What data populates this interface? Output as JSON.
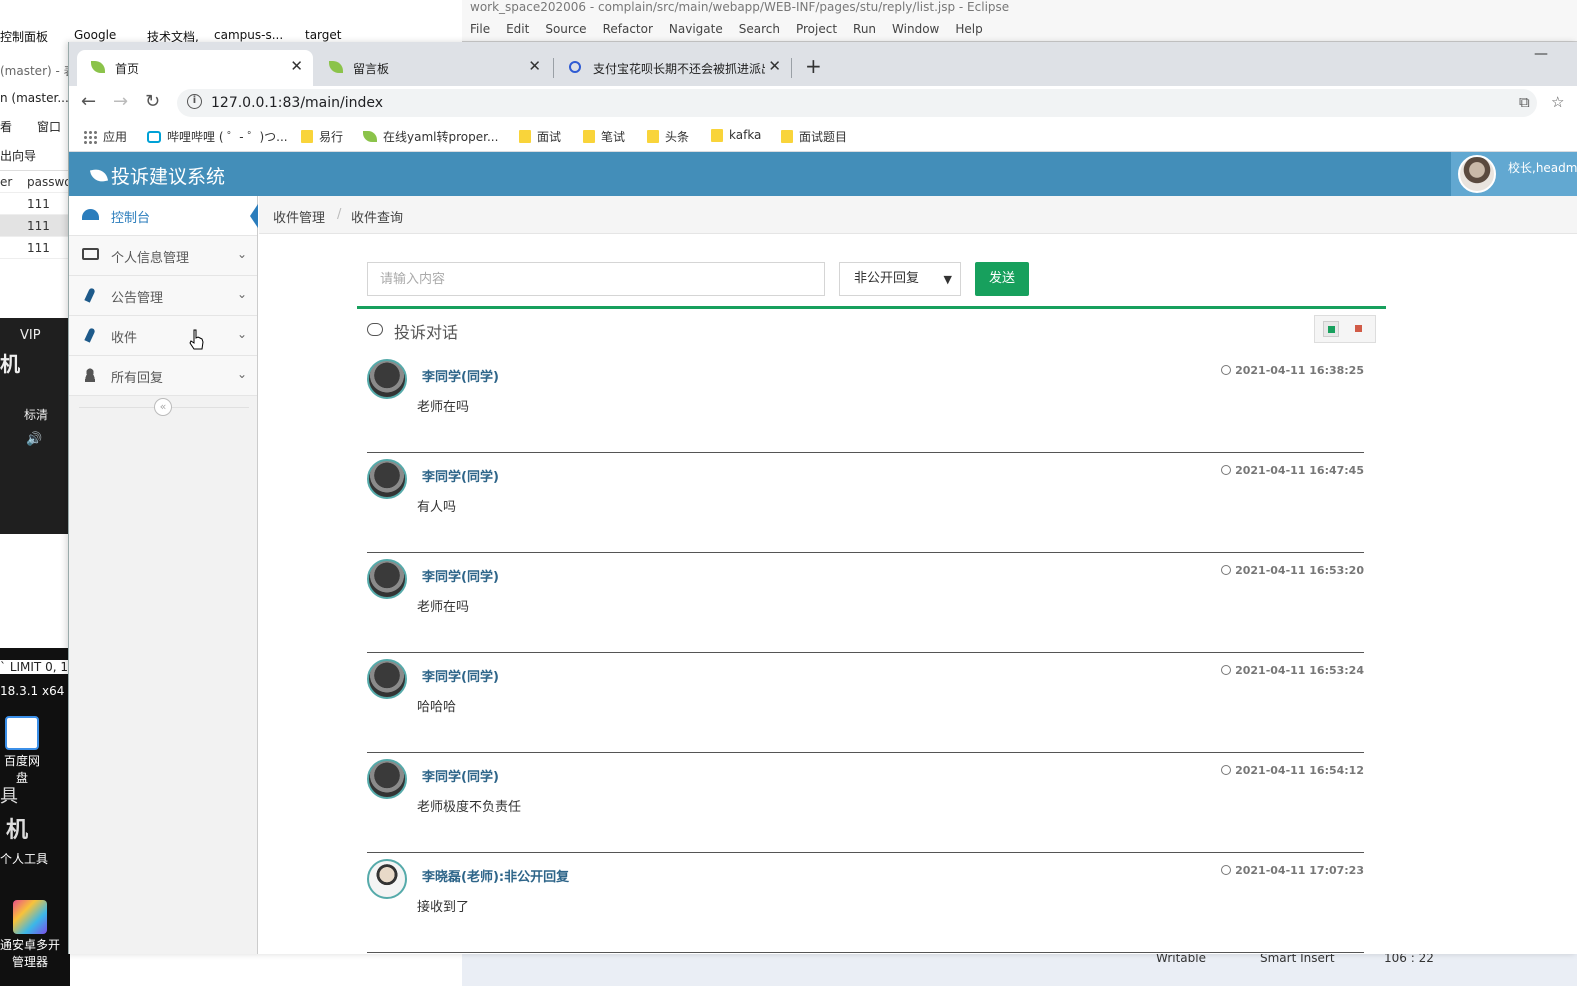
{
  "desktop": {
    "top_icons": [
      "控制面板",
      "Google",
      "技术文档,",
      "campus-s...",
      "target"
    ],
    "left_icons": [
      {
        "label": "百度网盘"
      },
      {
        "label": "个人工具"
      },
      {
        "label": "管理器"
      }
    ],
    "fragments": {
      "master1": "(master) - 表",
      "master2": "n (master...",
      "menu_view": "看",
      "menu_window": "窗口",
      "export": "出向导",
      "col_user": "er",
      "col_pass": "passwo",
      "cell_value": "111",
      "vip": "VIP",
      "machine": "机",
      "quality": "标清",
      "limit": "` LIMIT 0, 1",
      "version": "18.3.1 x64",
      "tool_char": "具",
      "machine2": "机",
      "tongan": "通安卓多开"
    }
  },
  "eclipse": {
    "title": "work_space202006 - complain/src/main/webapp/WEB-INF/pages/stu/reply/list.jsp - Eclipse",
    "menu": [
      "File",
      "Edit",
      "Source",
      "Refactor",
      "Navigate",
      "Search",
      "Project",
      "Run",
      "Window",
      "Help"
    ],
    "status": {
      "writable": "Writable",
      "insert": "Smart Insert",
      "position": "106 : 22"
    }
  },
  "browser": {
    "tabs": [
      {
        "label": "首页",
        "active": true
      },
      {
        "label": "留言板",
        "active": false
      },
      {
        "label": "支付宝花呗长期不还会被抓进派出",
        "active": false
      }
    ],
    "url": "127.0.0.1:83/main/index",
    "bookmarks": [
      "应用",
      "哔哩哔哩 ( ゜- ゜)つ...",
      "易行",
      "在线yaml转proper...",
      "面试",
      "笔试",
      "头条",
      "kafka",
      "面试题目"
    ]
  },
  "app": {
    "brand": "投诉建议系统",
    "user_name": "校长,headm",
    "sidebar": [
      {
        "label": "控制台",
        "icon": "dashboard-icon",
        "active": true,
        "has_arrow": false
      },
      {
        "label": "个人信息管理",
        "icon": "desktop-icon",
        "active": false,
        "has_arrow": true
      },
      {
        "label": "公告管理",
        "icon": "pencil-icon",
        "active": false,
        "has_arrow": true
      },
      {
        "label": "收件",
        "icon": "pencil-icon",
        "active": false,
        "has_arrow": true
      },
      {
        "label": "所有回复",
        "icon": "user-icon",
        "active": false,
        "has_arrow": true
      }
    ],
    "breadcrumbs": [
      "收件管理",
      "收件查询"
    ],
    "form": {
      "input_placeholder": "请输入内容",
      "input_value": "",
      "select_value": "非公开回复",
      "send_label": "发送"
    },
    "widget_title": "投诉对话",
    "messages": [
      {
        "name": "李同学(同学)",
        "time": "2021-04-11 16:38:25",
        "text": "老师在吗",
        "role": "student"
      },
      {
        "name": "李同学(同学)",
        "time": "2021-04-11 16:47:45",
        "text": "有人吗",
        "role": "student"
      },
      {
        "name": "李同学(同学)",
        "time": "2021-04-11 16:53:20",
        "text": "老师在吗",
        "role": "student"
      },
      {
        "name": "李同学(同学)",
        "time": "2021-04-11 16:53:24",
        "text": "哈哈哈",
        "role": "student"
      },
      {
        "name": "李同学(同学)",
        "time": "2021-04-11 16:54:12",
        "text": "老师极度不负责任",
        "role": "student"
      },
      {
        "name": "李晓磊(老师):非公开回复",
        "time": "2021-04-11 17:07:23",
        "text": "接收到了",
        "role": "teacher"
      }
    ]
  },
  "colors": {
    "header": "#438eb9",
    "accent_green": "#17a05d",
    "active_blue": "#2b7dbc",
    "name_blue": "#2e6589"
  }
}
